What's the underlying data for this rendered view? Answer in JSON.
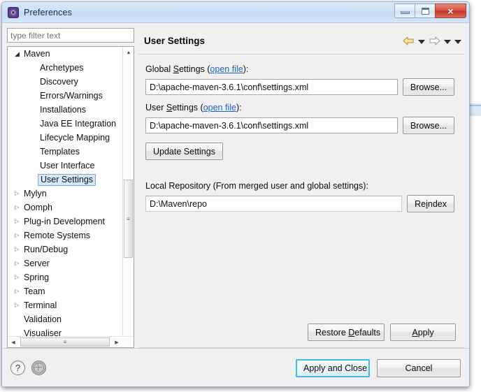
{
  "window": {
    "title": "Preferences",
    "icon": "preferences-gear-icon",
    "controls": {
      "minimize": "minimize-icon",
      "maximize": "maximize-icon",
      "close": "×"
    }
  },
  "filter": {
    "placeholder": "type filter text",
    "value": ""
  },
  "tree": {
    "items": [
      {
        "label": "Maven",
        "level": 1,
        "twisty": "expanded",
        "selected": false
      },
      {
        "label": "Archetypes",
        "level": 2,
        "twisty": "none",
        "selected": false
      },
      {
        "label": "Discovery",
        "level": 2,
        "twisty": "none",
        "selected": false
      },
      {
        "label": "Errors/Warnings",
        "level": 2,
        "twisty": "none",
        "selected": false
      },
      {
        "label": "Installations",
        "level": 2,
        "twisty": "none",
        "selected": false
      },
      {
        "label": "Java EE Integration",
        "level": 2,
        "twisty": "none",
        "selected": false
      },
      {
        "label": "Lifecycle Mapping",
        "level": 2,
        "twisty": "none",
        "selected": false
      },
      {
        "label": "Templates",
        "level": 2,
        "twisty": "none",
        "selected": false
      },
      {
        "label": "User Interface",
        "level": 2,
        "twisty": "none",
        "selected": false
      },
      {
        "label": "User Settings",
        "level": 2,
        "twisty": "none",
        "selected": true
      },
      {
        "label": "Mylyn",
        "level": 1,
        "twisty": "collapsed",
        "selected": false
      },
      {
        "label": "Oomph",
        "level": 1,
        "twisty": "collapsed",
        "selected": false
      },
      {
        "label": "Plug-in Development",
        "level": 1,
        "twisty": "collapsed",
        "selected": false
      },
      {
        "label": "Remote Systems",
        "level": 1,
        "twisty": "collapsed",
        "selected": false
      },
      {
        "label": "Run/Debug",
        "level": 1,
        "twisty": "collapsed",
        "selected": false
      },
      {
        "label": "Server",
        "level": 1,
        "twisty": "collapsed",
        "selected": false
      },
      {
        "label": "Spring",
        "level": 1,
        "twisty": "collapsed",
        "selected": false
      },
      {
        "label": "Team",
        "level": 1,
        "twisty": "collapsed",
        "selected": false
      },
      {
        "label": "Terminal",
        "level": 1,
        "twisty": "collapsed",
        "selected": false
      },
      {
        "label": "Validation",
        "level": 1,
        "twisty": "none",
        "selected": false
      },
      {
        "label": "Visualiser",
        "level": 1,
        "twisty": "none",
        "selected": false
      }
    ],
    "scroll_up": "▲",
    "scroll_down": "▼",
    "scroll_left": "◀",
    "scroll_right": "▶",
    "thumb_grip": "≡"
  },
  "page": {
    "title": "User Settings",
    "nav": {
      "back": "back-arrow-icon",
      "back_menu": "chevron-down-icon",
      "forward": "forward-arrow-icon",
      "forward_menu": "chevron-down-icon",
      "view_menu": "chevron-down-icon"
    },
    "global_settings": {
      "label_pre": "Global ",
      "label_mnemonic": "S",
      "label_post": "ettings (",
      "link": "open file",
      "label_end": "):",
      "value": "D:\\apache-maven-3.6.1\\conf\\settings.xml",
      "browse_label": "Browse..."
    },
    "user_settings": {
      "label_pre": "User ",
      "label_mnemonic": "S",
      "label_post": "ettings (",
      "link": "open file",
      "label_end": "):",
      "value": "D:\\apache-maven-3.6.1\\conf\\settings.xml",
      "browse_label": "Browse..."
    },
    "update_settings_label": "Update Settings",
    "local_repository": {
      "label": "Local Repository (From merged user and global settings):",
      "value": "D:\\Maven\\repo",
      "reindex_pre": "Re",
      "reindex_mnemonic": "i",
      "reindex_post": "ndex"
    },
    "restore_defaults": {
      "pre": "Restore ",
      "mnemonic": "D",
      "post": "efaults"
    },
    "apply": {
      "mnemonic": "A",
      "post": "pply"
    }
  },
  "footer": {
    "help_icon": "?",
    "globe_icon": "globe-icon",
    "apply_and_close_label": "Apply and Close",
    "cancel_label": "Cancel"
  },
  "colors": {
    "accent_focus": "#3fb9e8",
    "link": "#1c66c7",
    "selection": "#d6e8fb",
    "close_button": "#c23323",
    "back_arrow": "#f2d98a"
  }
}
